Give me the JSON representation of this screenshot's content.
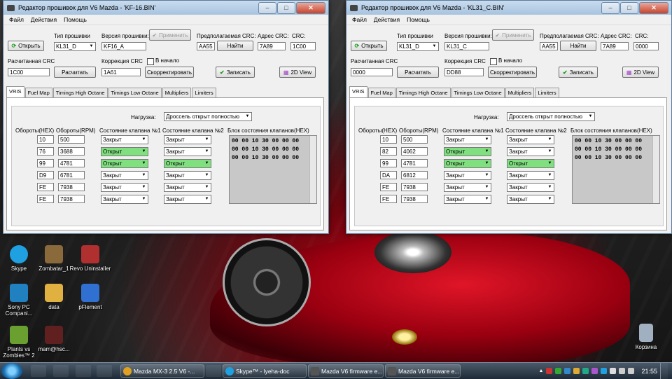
{
  "desktop": {
    "icons": [
      {
        "label": "Skype",
        "color": "#1fa0e0"
      },
      {
        "label": "Zombatar_1",
        "color": "#8a6a3a"
      },
      {
        "label": "Revo Uninstaller",
        "color": "#b03030"
      },
      {
        "label": "Sony PC Compani...",
        "color": "#2080c0"
      },
      {
        "label": "data",
        "color": "#e0b040"
      },
      {
        "label": "pFlement",
        "color": "#3070d0"
      },
      {
        "label": "Plants vs Zombies™ 2",
        "color": "#6aa030"
      },
      {
        "label": "mam@hsc...",
        "color": "#602020"
      },
      {
        "label": "Корзина",
        "color": "#a0b0c0"
      }
    ]
  },
  "windows": [
    {
      "title": "Редактор прошивок для V6 Mazda - 'KF-16.BIN'",
      "menu": [
        "Файл",
        "Действия",
        "Помощь"
      ],
      "open_label": "Открыть",
      "fw_type_label": "Тип прошивки",
      "fw_type_value": "KL31_D",
      "fw_version_label": "Версия прошивки:",
      "fw_version_value": "KF16_A",
      "apply_label": "Применить",
      "exp_crc_label": "Предполагаемая CRC:",
      "exp_crc_value": "AA55",
      "find_label": "Найти",
      "crc_addr_label": "Адрес CRC:",
      "crc_addr_value": "7A89",
      "crc_label": "CRC:",
      "crc_value": "1C00",
      "calc_crc_label": "Расчитанная CRC",
      "calc_crc_value": "1C00",
      "calc_label": "Расчитать",
      "corr_crc_label": "Коррекция CRC",
      "corr_crc_value": "1A61",
      "at_start_label": "В начало",
      "correct_label": "Скорректировать",
      "write_label": "Записать",
      "view2d_label": "2D View",
      "tabs": [
        "VRIS",
        "Fuel Map",
        "Timings High Octane",
        "Timings Low Octane",
        "Multipliers",
        "Limiters"
      ],
      "load_label": "Нагрузка:",
      "load_value": "Дроссель открыт полностью",
      "col_hex": "Обороты(HEX)",
      "col_rpm": "Обороты(RPM)",
      "col_v1": "Состояние клапана №1",
      "col_v2": "Состояние клапана №2",
      "col_block": "Блок состояния клапанов(HEX)",
      "rows": [
        {
          "hex": "10",
          "rpm": "500",
          "v1": "Закрыт",
          "v2": "Закрыт",
          "v1_open": false,
          "v2_open": false
        },
        {
          "hex": "76",
          "rpm": "3688",
          "v1": "Открыт",
          "v2": "Закрыт",
          "v1_open": true,
          "v2_open": false
        },
        {
          "hex": "99",
          "rpm": "4781",
          "v1": "Открыт",
          "v2": "Открыт",
          "v1_open": true,
          "v2_open": true
        },
        {
          "hex": "D9",
          "rpm": "6781",
          "v1": "Закрыт",
          "v2": "Закрыт",
          "v1_open": false,
          "v2_open": false
        },
        {
          "hex": "FE",
          "rpm": "7938",
          "v1": "Закрыт",
          "v2": "Закрыт",
          "v1_open": false,
          "v2_open": false
        },
        {
          "hex": "FE",
          "rpm": "7938",
          "v1": "Закрыт",
          "v2": "Закрыт",
          "v1_open": false,
          "v2_open": false
        }
      ],
      "block_lines": [
        "00 00 10 30 00 00 00",
        "00 00 10 30 00 00 00",
        "00 00 10 30 00 00 00"
      ]
    },
    {
      "title": "Редактор прошивок для V6 Mazda - 'KL31_C.BIN'",
      "menu": [
        "Файл",
        "Действия",
        "Помощь"
      ],
      "open_label": "Открыть",
      "fw_type_label": "Тип прошивки",
      "fw_type_value": "KL31_D",
      "fw_version_label": "Версия прошивки:",
      "fw_version_value": "KL31_C",
      "apply_label": "Применить",
      "exp_crc_label": "Предполагаемая CRC:",
      "exp_crc_value": "AA55",
      "find_label": "Найти",
      "crc_addr_label": "Адрес CRC:",
      "crc_addr_value": "7A89",
      "crc_label": "CRC:",
      "crc_value": "0000",
      "calc_crc_label": "Расчитанная CRC",
      "calc_crc_value": "0000",
      "calc_label": "Расчитать",
      "corr_crc_label": "Коррекция CRC",
      "corr_crc_value": "DD88",
      "at_start_label": "В начало",
      "correct_label": "Скорректировать",
      "write_label": "Записать",
      "view2d_label": "2D View",
      "tabs": [
        "VRIS",
        "Fuel Map",
        "Timings High Octane",
        "Timings Low Octane",
        "Multipliers",
        "Limiters"
      ],
      "load_label": "Нагрузка:",
      "load_value": "Дроссель открыт полностью",
      "col_hex": "Обороты(HEX)",
      "col_rpm": "Обороты(RPM)",
      "col_v1": "Состояние клапана №1",
      "col_v2": "Состояние клапана №2",
      "col_block": "Блок состояния клапанов(HEX)",
      "rows": [
        {
          "hex": "10",
          "rpm": "500",
          "v1": "Закрыт",
          "v2": "Закрыт",
          "v1_open": false,
          "v2_open": false
        },
        {
          "hex": "82",
          "rpm": "4062",
          "v1": "Открыт",
          "v2": "Закрыт",
          "v1_open": true,
          "v2_open": false
        },
        {
          "hex": "99",
          "rpm": "4781",
          "v1": "Открыт",
          "v2": "Открыт",
          "v1_open": true,
          "v2_open": true
        },
        {
          "hex": "DA",
          "rpm": "6812",
          "v1": "Закрыт",
          "v2": "Закрыт",
          "v1_open": false,
          "v2_open": false
        },
        {
          "hex": "FE",
          "rpm": "7938",
          "v1": "Закрыт",
          "v2": "Закрыт",
          "v1_open": false,
          "v2_open": false
        },
        {
          "hex": "FE",
          "rpm": "7938",
          "v1": "Закрыт",
          "v2": "Закрыт",
          "v1_open": false,
          "v2_open": false
        }
      ],
      "block_lines": [
        "00 00 10 30 00 00 00",
        "00 00 10 30 00 00 00",
        "00 00 10 30 00 00 00"
      ]
    }
  ],
  "taskbar": {
    "tasks": [
      {
        "label": "Mazda MX-3 2.5 V6 -...",
        "color": "#e0a020"
      },
      {
        "label": "Skype™ - lyeha-doc",
        "color": "#1fa0e0"
      },
      {
        "label": "Mazda V6 firmware e...",
        "color": "#555"
      },
      {
        "label": "Mazda V6 firmware e...",
        "color": "#555"
      }
    ],
    "clock": "21:55"
  }
}
